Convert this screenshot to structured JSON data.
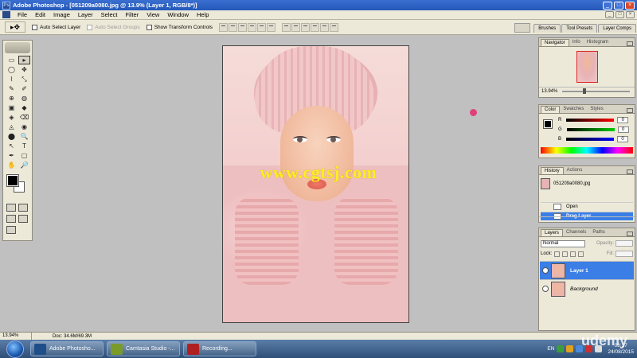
{
  "window": {
    "title": "Adobe Photoshop - [051209a0080.jpg @ 13.9% (Layer 1, RGB/8*)]",
    "min": "_",
    "max": "□",
    "close": "×"
  },
  "menu": {
    "items": [
      "File",
      "Edit",
      "Image",
      "Layer",
      "Select",
      "Filter",
      "View",
      "Window",
      "Help"
    ]
  },
  "options": {
    "tool_glyph": "▸✥",
    "auto_select_layer": "Auto Select Layer",
    "auto_select_groups": "Auto Select Groups",
    "show_transform_controls": "Show Transform Controls"
  },
  "well_tabs": [
    "Brushes",
    "Tool Presets",
    "Layer Comps"
  ],
  "tools": [
    "▭",
    "▸",
    "◯",
    "✥",
    "⌇",
    "⤡",
    "✎",
    "✐",
    "⊕",
    "◍",
    "▣",
    "◆",
    "◈",
    "⌫",
    "◬",
    "◉",
    "⬤",
    "🔍",
    "↖",
    "T",
    "✒",
    "▢",
    "✋",
    "🔎"
  ],
  "document": {
    "watermark": "www.cgtsj.com"
  },
  "panels": {
    "navigator": {
      "tabs": [
        "Navigator",
        "Info",
        "Histogram"
      ],
      "zoom": "13.94%"
    },
    "color": {
      "tabs": [
        "Color",
        "Swatches",
        "Styles"
      ],
      "channels": [
        {
          "label": "R",
          "value": "0",
          "color": "#cc0000"
        },
        {
          "label": "G",
          "value": "0",
          "color": "#00aa00"
        },
        {
          "label": "B",
          "value": "0",
          "color": "#0000cc"
        }
      ]
    },
    "history": {
      "tabs": [
        "History",
        "Actions"
      ],
      "snapshot": "051209a0080.jpg",
      "items": [
        "Open",
        "Drag Layer"
      ]
    },
    "layers": {
      "tabs": [
        "Layers",
        "Channels",
        "Paths"
      ],
      "blend_mode": "Normal",
      "opacity_label": "Opacity:",
      "lock_label": "Lock:",
      "fill_label": "Fill:",
      "items": [
        "Layer 1",
        "Background"
      ]
    }
  },
  "status": {
    "zoom": "13.94%",
    "doc": "Doc: 34.6M/69.3M"
  },
  "taskbar": {
    "tasks": [
      {
        "label": "Adobe Photosho...",
        "color": "#1f4f8a"
      },
      {
        "label": "Camtasia Studio -...",
        "color": "#7a9a2a"
      },
      {
        "label": "Recording...",
        "color": "#b02020"
      }
    ],
    "lang": "EN",
    "time": "08:17",
    "date": "24/08/2015",
    "brand": "udemy"
  }
}
